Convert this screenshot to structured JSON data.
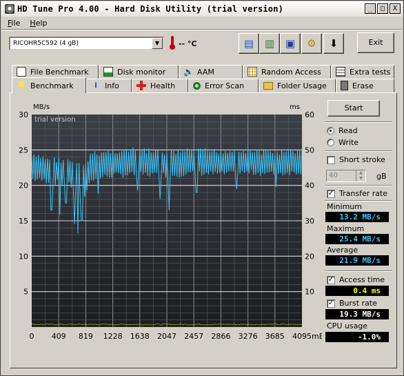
{
  "window": {
    "title": "HD Tune Pro 4.00 - Hard Disk Utility (trial version)",
    "controls": [
      "_",
      "□",
      "X"
    ]
  },
  "menu": [
    "File",
    "Help"
  ],
  "toolbar": {
    "drive": "RICOHR5C592 (4 gB)",
    "temperature": "-- °C",
    "buttons": [
      {
        "name": "copy-text-icon",
        "glyph": "▤"
      },
      {
        "name": "copy-image-icon",
        "glyph": "▥"
      },
      {
        "name": "save-icon",
        "glyph": "▣"
      },
      {
        "name": "options-icon",
        "glyph": "⚙"
      },
      {
        "name": "download-icon",
        "glyph": "⬇"
      }
    ],
    "exit_label": "Exit"
  },
  "tabs_top": [
    {
      "label": "File Benchmark",
      "icon": "file-benchmark-icon"
    },
    {
      "label": "Disk monitor",
      "icon": "disk-monitor-icon"
    },
    {
      "label": "AAM",
      "icon": "speaker-icon"
    },
    {
      "label": "Random Access",
      "icon": "random-access-icon"
    },
    {
      "label": "Extra tests",
      "icon": "extra-tests-icon"
    }
  ],
  "tabs_bottom": [
    {
      "label": "Benchmark",
      "icon": "benchmark-bulb-icon",
      "active": true
    },
    {
      "label": "Info",
      "icon": "info-icon"
    },
    {
      "label": "Health",
      "icon": "health-cross-icon"
    },
    {
      "label": "Error Scan",
      "icon": "magnifier-icon"
    },
    {
      "label": "Folder Usage",
      "icon": "folder-icon"
    },
    {
      "label": "Erase",
      "icon": "trash-icon"
    }
  ],
  "side": {
    "start_label": "Start",
    "read_label": "Read",
    "write_label": "Write",
    "mode": "read",
    "short_stroke_label": "Short stroke",
    "short_stroke_checked": false,
    "stroke_value": "40",
    "stroke_unit": "gB",
    "transfer_rate_label": "Transfer rate",
    "transfer_rate_checked": true,
    "minimum_label": "Minimum",
    "minimum_value": "13.2 MB/s",
    "maximum_label": "Maximum",
    "maximum_value": "25.4 MB/s",
    "average_label": "Average",
    "average_value": "21.9 MB/s",
    "access_time_label": "Access time",
    "access_time_checked": true,
    "access_time_value": "0.4 ms",
    "burst_rate_label": "Burst rate",
    "burst_rate_checked": true,
    "burst_rate_value": "19.3 MB/s",
    "cpu_label": "CPU usage",
    "cpu_value": "-1.0%",
    "colors": {
      "transfer": "#3fc3f5",
      "access": "#ffff00",
      "cpu": "#ffffff"
    }
  },
  "chart_data": {
    "type": "line",
    "watermark": "trial version",
    "left_unit": "MB/s",
    "right_unit": "ms",
    "left_ticks": [
      30,
      25,
      20,
      15,
      10,
      5
    ],
    "right_ticks": [
      60,
      50,
      40,
      30,
      20,
      10
    ],
    "x_ticks": [
      "0",
      "409",
      "819",
      "1228",
      "1638",
      "2047",
      "2457",
      "2866",
      "3276",
      "3685",
      "4095mB"
    ],
    "ylim": [
      0,
      30
    ],
    "y2lim": [
      0,
      60
    ],
    "xlim": [
      0,
      4095
    ],
    "grid": true,
    "series": [
      {
        "name": "Transfer rate",
        "color": "#3fc3f5",
        "band": {
          "x": [
            0,
            409,
            600,
            760,
            819,
            900,
            1228,
            1638,
            2047,
            2457,
            2866,
            3276,
            3685,
            4095
          ],
          "min": [
            20.5,
            20.0,
            19.5,
            17.5,
            18.5,
            20.5,
            21.0,
            21.2,
            21.0,
            21.3,
            21.2,
            21.4,
            21.2,
            21.5
          ],
          "max": [
            24.5,
            24.0,
            23.8,
            23.0,
            23.5,
            24.8,
            25.2,
            25.4,
            25.0,
            25.3,
            25.2,
            25.3,
            25.0,
            25.3
          ]
        },
        "spikes": [
          {
            "x": 300,
            "y": 16.5
          },
          {
            "x": 420,
            "y": 15.8
          },
          {
            "x": 520,
            "y": 17.5
          },
          {
            "x": 650,
            "y": 14.5
          },
          {
            "x": 700,
            "y": 13.2
          },
          {
            "x": 760,
            "y": 15.0
          },
          {
            "x": 1000,
            "y": 18.8
          },
          {
            "x": 1600,
            "y": 19.2
          },
          {
            "x": 1950,
            "y": 18.0
          },
          {
            "x": 2080,
            "y": 16.5
          },
          {
            "x": 2500,
            "y": 19.0
          },
          {
            "x": 3100,
            "y": 19.5
          },
          {
            "x": 3700,
            "y": 19.8
          }
        ]
      },
      {
        "name": "Access time",
        "color": "#ffff00",
        "axis": "right",
        "level": 0.4
      }
    ]
  }
}
